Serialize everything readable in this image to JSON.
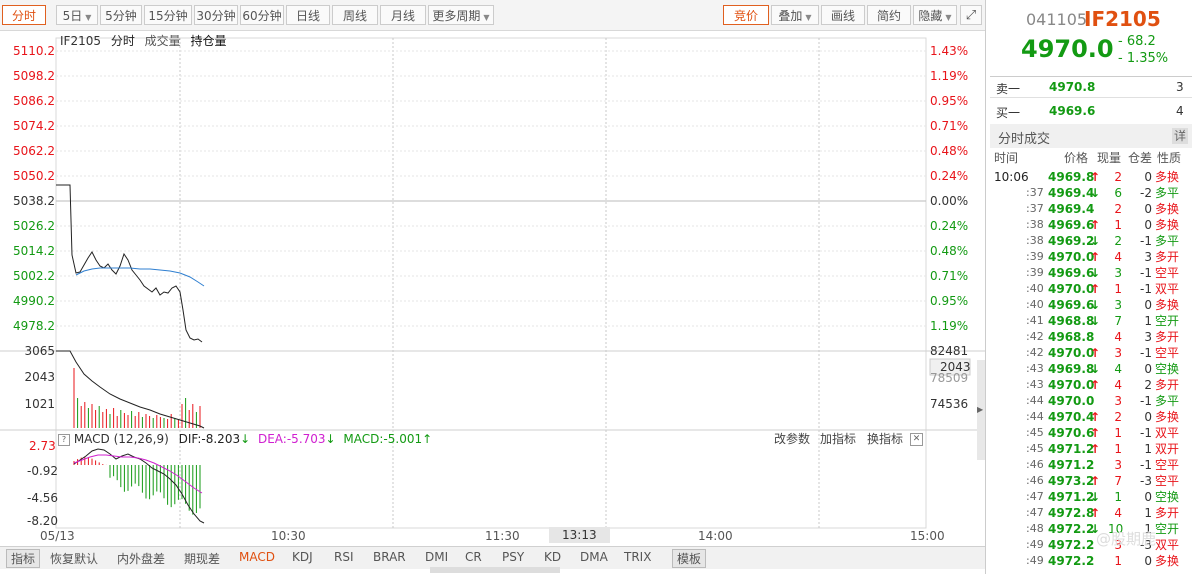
{
  "toolbar": {
    "buttons": [
      "分时",
      "5日",
      "5分钟",
      "15分钟",
      "30分钟",
      "60分钟",
      "日线",
      "周线",
      "月线",
      "更多周期"
    ],
    "right_buttons": [
      "竞价",
      "叠加",
      "画线",
      "简约",
      "隐藏"
    ]
  },
  "chart": {
    "legend": {
      "symbol": "IF2105",
      "mode": "分时",
      "vol": "成交量",
      "oi": "持仓量"
    },
    "price_axis_left": [
      "5110.2",
      "5098.2",
      "5086.2",
      "5074.2",
      "5062.2",
      "5050.2",
      "5038.2",
      "5026.2",
      "5014.2",
      "5002.2",
      "4990.2",
      "4978.2"
    ],
    "price_axis_right": [
      "1.43%",
      "1.19%",
      "0.95%",
      "0.71%",
      "0.48%",
      "0.24%",
      "0.00%",
      "0.24%",
      "0.48%",
      "0.71%",
      "0.95%",
      "1.19%"
    ],
    "volume_axis_left": [
      "3065",
      "2043",
      "1021"
    ],
    "volume_axis_right": [
      "82481",
      "2043",
      "78509",
      "74536"
    ],
    "macd_header": {
      "title": "MACD (12,26,9)",
      "dif": "DIF:-8.203",
      "dea": "DEA:-5.703",
      "macd": "MACD:-5.001",
      "change_params": "改参数",
      "add_indicator": "加指标",
      "switch_indicator": "换指标"
    },
    "macd_axis": [
      "2.73",
      "-0.92",
      "-4.56",
      "-8.20"
    ],
    "time_axis": [
      "05/13",
      "10:30",
      "11:30",
      "13:13",
      "14:00",
      "15:00"
    ]
  },
  "bottom_tabs": [
    "指标",
    "恢复默认",
    "内外盘差",
    "期现差",
    "MACD",
    "KDJ",
    "RSI",
    "BRAR",
    "DMI",
    "CR",
    "PSY",
    "KD",
    "DMA",
    "TRIX",
    "模板"
  ],
  "quote": {
    "code": "041105",
    "symbol": "IF2105",
    "price": "4970.0",
    "change": "- 68.2",
    "change_pct": "- 1.35%",
    "ask_label": "卖一",
    "ask_price": "4970.8",
    "ask_vol": "3",
    "bid_label": "买一",
    "bid_price": "4969.6",
    "bid_vol": "4",
    "trades_title": "分时成交",
    "detail": "详",
    "headers": [
      "时间",
      "价格",
      "现量",
      "仓差",
      "性质"
    ]
  },
  "trades": [
    {
      "t": "10:06",
      "p": "4969.8",
      "d": "up",
      "v": "2",
      "oi": "0",
      "n": "多换",
      "nc": "red"
    },
    {
      "t": ":37",
      "p": "4969.4",
      "d": "down",
      "v": "6",
      "oi": "-2",
      "n": "多平",
      "nc": "green"
    },
    {
      "t": ":37",
      "p": "4969.4",
      "d": "",
      "v": "2",
      "oi": "0",
      "n": "多换",
      "nc": "red"
    },
    {
      "t": ":38",
      "p": "4969.6",
      "d": "up",
      "v": "1",
      "oi": "0",
      "n": "多换",
      "nc": "red"
    },
    {
      "t": ":38",
      "p": "4969.2",
      "d": "down",
      "v": "2",
      "oi": "-1",
      "n": "多平",
      "nc": "green"
    },
    {
      "t": ":39",
      "p": "4970.0",
      "d": "up",
      "v": "4",
      "oi": "3",
      "n": "多开",
      "nc": "red"
    },
    {
      "t": ":39",
      "p": "4969.6",
      "d": "down",
      "v": "3",
      "oi": "-1",
      "n": "空平",
      "nc": "red"
    },
    {
      "t": ":40",
      "p": "4970.0",
      "d": "up",
      "v": "1",
      "oi": "-1",
      "n": "双平",
      "nc": "red"
    },
    {
      "t": ":40",
      "p": "4969.6",
      "d": "down",
      "v": "3",
      "oi": "0",
      "n": "多换",
      "nc": "red"
    },
    {
      "t": ":41",
      "p": "4968.8",
      "d": "down",
      "v": "7",
      "oi": "1",
      "n": "空开",
      "nc": "green"
    },
    {
      "t": ":42",
      "p": "4968.8",
      "d": "",
      "v": "4",
      "oi": "3",
      "n": "多开",
      "nc": "red"
    },
    {
      "t": ":42",
      "p": "4970.0",
      "d": "up",
      "v": "3",
      "oi": "-1",
      "n": "空平",
      "nc": "red"
    },
    {
      "t": ":43",
      "p": "4969.8",
      "d": "down",
      "v": "4",
      "oi": "0",
      "n": "空换",
      "nc": "green"
    },
    {
      "t": ":43",
      "p": "4970.0",
      "d": "up",
      "v": "4",
      "oi": "2",
      "n": "多开",
      "nc": "red"
    },
    {
      "t": ":44",
      "p": "4970.0",
      "d": "",
      "v": "3",
      "oi": "-1",
      "n": "多平",
      "nc": "green"
    },
    {
      "t": ":44",
      "p": "4970.4",
      "d": "up",
      "v": "2",
      "oi": "0",
      "n": "多换",
      "nc": "red"
    },
    {
      "t": ":45",
      "p": "4970.6",
      "d": "up",
      "v": "1",
      "oi": "-1",
      "n": "双平",
      "nc": "red"
    },
    {
      "t": ":45",
      "p": "4971.2",
      "d": "up",
      "v": "1",
      "oi": "1",
      "n": "双开",
      "nc": "red"
    },
    {
      "t": ":46",
      "p": "4971.2",
      "d": "",
      "v": "3",
      "oi": "-1",
      "n": "空平",
      "nc": "red"
    },
    {
      "t": ":46",
      "p": "4973.2",
      "d": "up",
      "v": "7",
      "oi": "-3",
      "n": "空平",
      "nc": "red"
    },
    {
      "t": ":47",
      "p": "4971.2",
      "d": "down",
      "v": "1",
      "oi": "0",
      "n": "空换",
      "nc": "green"
    },
    {
      "t": ":47",
      "p": "4972.8",
      "d": "up",
      "v": "4",
      "oi": "1",
      "n": "多开",
      "nc": "red"
    },
    {
      "t": ":48",
      "p": "4972.2",
      "d": "down",
      "v": "10",
      "oi": "1",
      "n": "空开",
      "nc": "green"
    },
    {
      "t": ":49",
      "p": "4972.2",
      "d": "",
      "v": "3",
      "oi": "-3",
      "n": "双平",
      "nc": "red"
    },
    {
      "t": ":49",
      "p": "4972.2",
      "d": "",
      "v": "1",
      "oi": "0",
      "n": "多换",
      "nc": "red"
    }
  ],
  "watermark": "@股期鹿",
  "colors": {
    "up": "#e8141a",
    "down": "#139a13",
    "accent": "#e05010",
    "price_line": "#222222",
    "avg_line": "#2f7fd0",
    "dea": "#d020d0"
  }
}
